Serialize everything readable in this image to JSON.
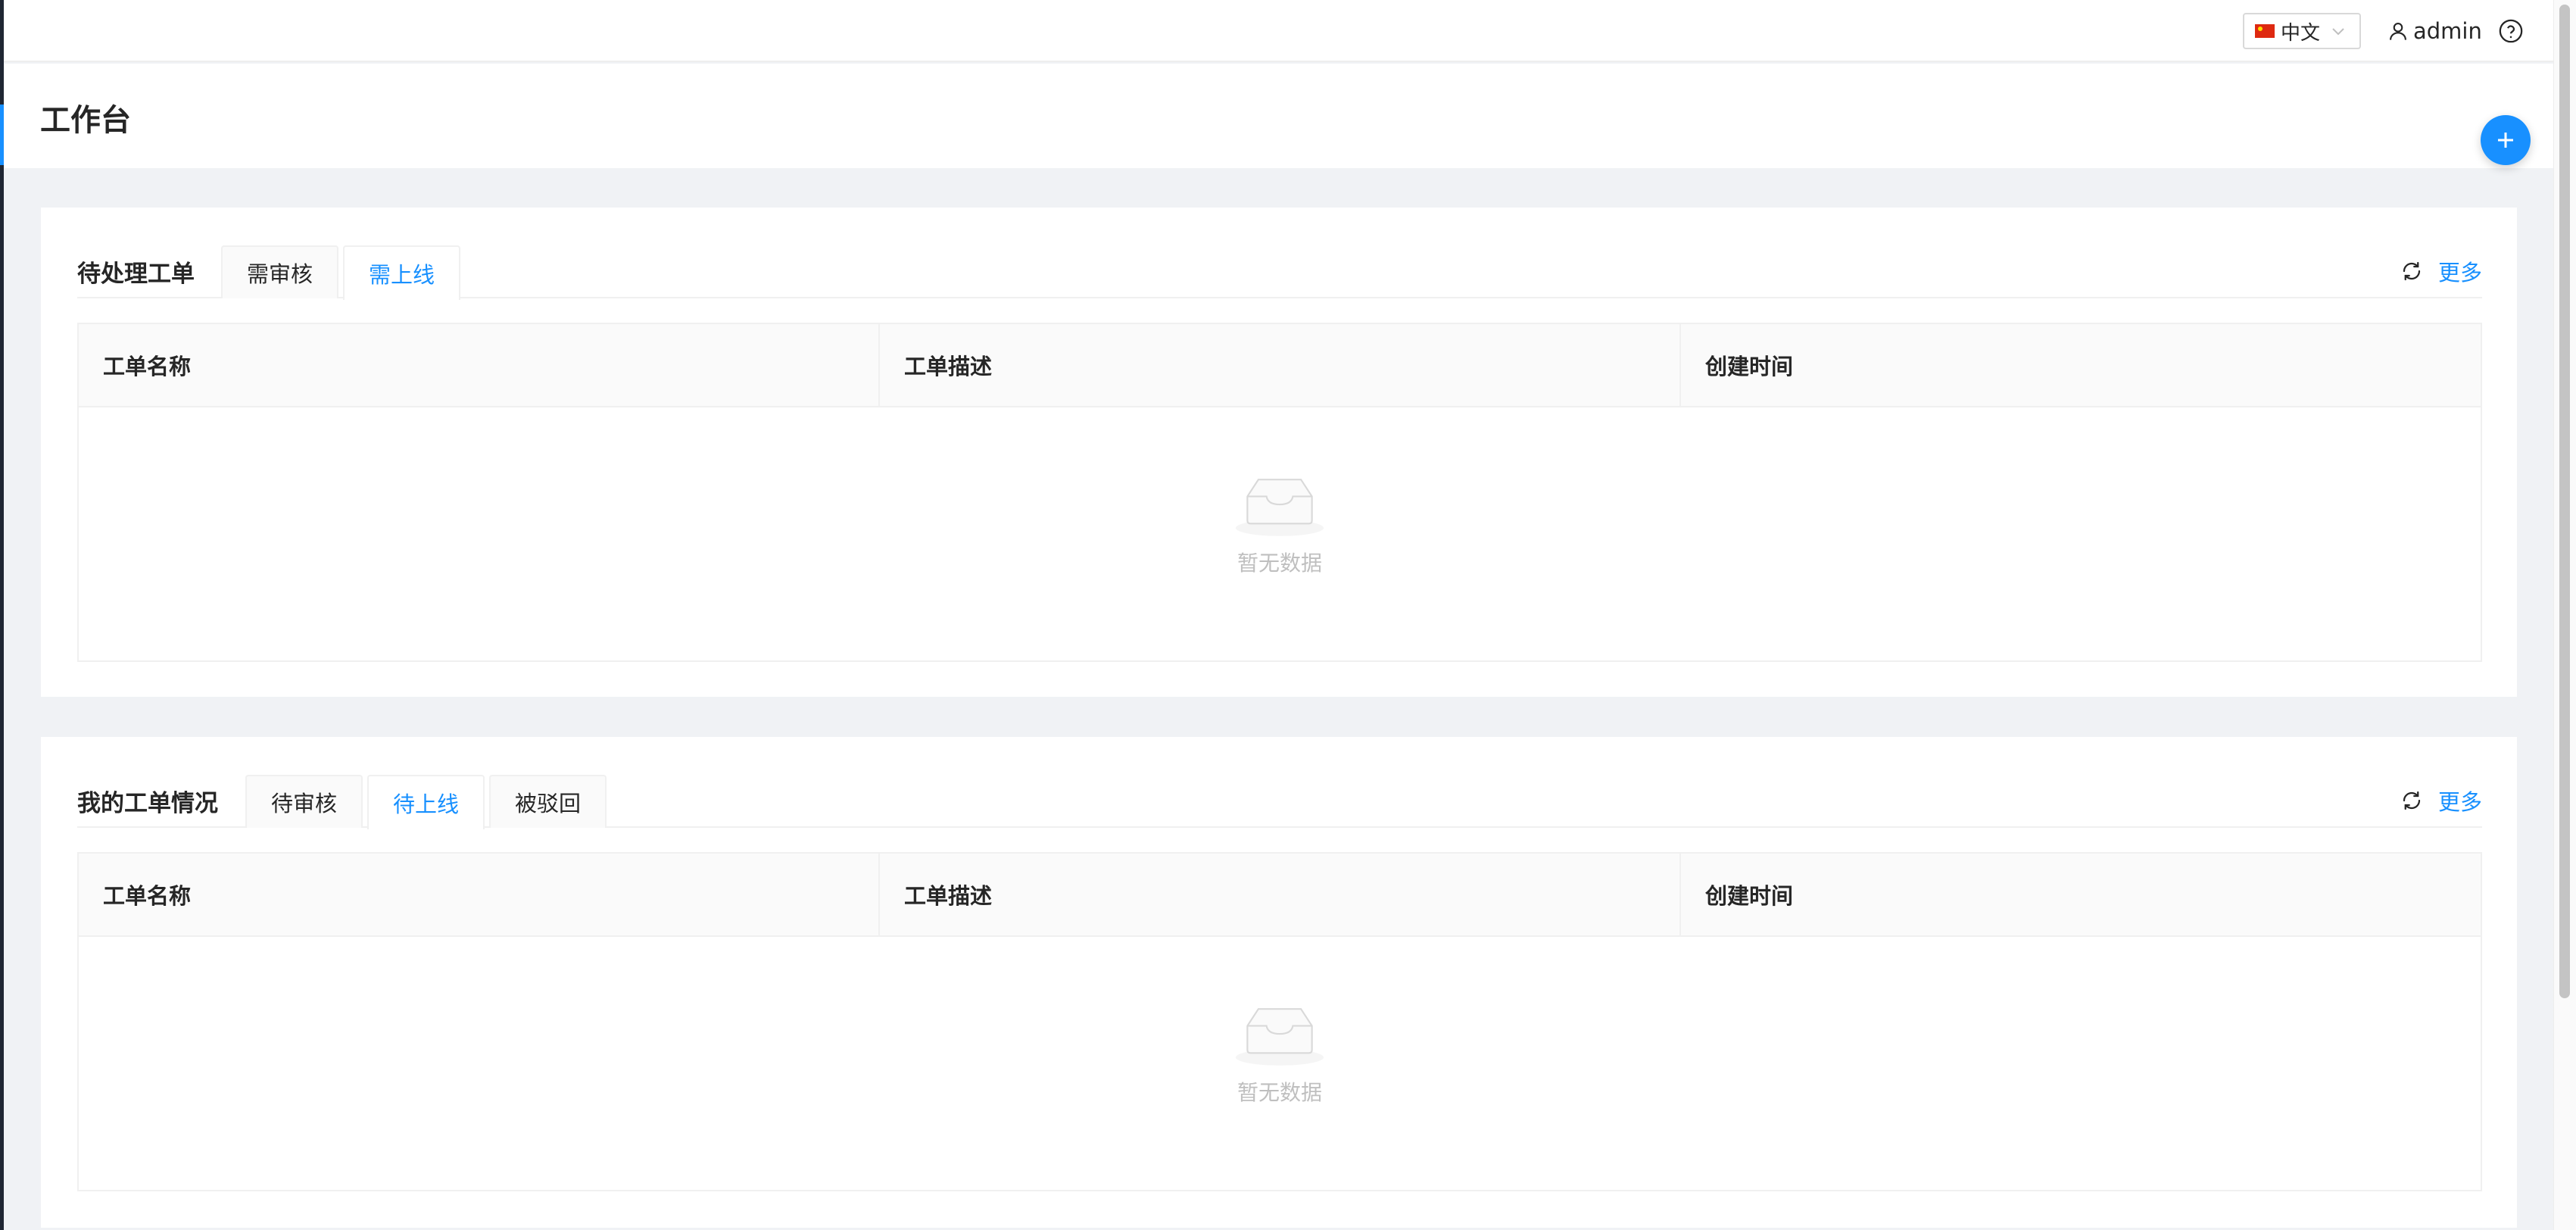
{
  "header": {
    "language": "中文",
    "username": "admin"
  },
  "page": {
    "title": "工作台"
  },
  "pending_card": {
    "title": "待处理工单",
    "tabs": [
      {
        "label": "需审核",
        "active": false
      },
      {
        "label": "需上线",
        "active": true
      }
    ],
    "more_label": "更多",
    "columns": [
      "工单名称",
      "工单描述",
      "创建时间"
    ],
    "empty_text": "暂无数据"
  },
  "my_card": {
    "title": "我的工单情况",
    "tabs": [
      {
        "label": "待审核",
        "active": false
      },
      {
        "label": "待上线",
        "active": true
      },
      {
        "label": "被驳回",
        "active": false
      }
    ],
    "more_label": "更多",
    "columns": [
      "工单名称",
      "工单描述",
      "创建时间"
    ],
    "empty_text": "暂无数据"
  },
  "colors": {
    "accent": "#1890ff",
    "sidebar": "#1f2633",
    "background": "#f0f2f5"
  }
}
